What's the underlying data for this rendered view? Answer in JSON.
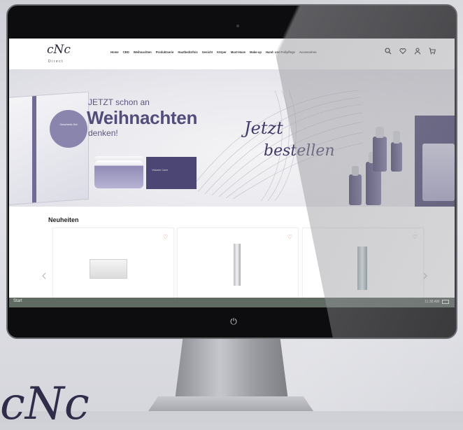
{
  "colors": {
    "brand_purple": "#524d7a",
    "taskbar": "#5f6a63",
    "heart": "#e27b63",
    "bezel": "#0d0d0f"
  },
  "site": {
    "logo_mark": "cNc",
    "logo_sub": "Direct",
    "nav": [
      "Home",
      "CBD",
      "Weihnachten",
      "Produktserie",
      "Hautbedürfnis",
      "Gesicht",
      "Körper",
      "Must-Have",
      "Make-up",
      "Hand- und Fußpflege",
      "Accessoires"
    ],
    "header_icons": [
      "search-icon",
      "heart-icon",
      "user-icon",
      "cart-icon"
    ]
  },
  "hero": {
    "kicker": "JETZT schon an",
    "title": "Weihnachten",
    "sub": "denken!",
    "script_line1": "Jetzt",
    "script_line2": "bestellen",
    "box_label": "Vitamin Care",
    "gift_tag": "Geschenk-Set"
  },
  "section": {
    "title": "Neuheiten"
  },
  "carousel": {
    "prev_icon": "chevron-left-icon",
    "next_icon": "chevron-right-icon",
    "heart_glyph": "♡"
  },
  "taskbar": {
    "start": "Start",
    "time": "11:38 AM"
  },
  "device": {
    "power_glyph": "⏻"
  },
  "background": {
    "script": "cNc"
  }
}
